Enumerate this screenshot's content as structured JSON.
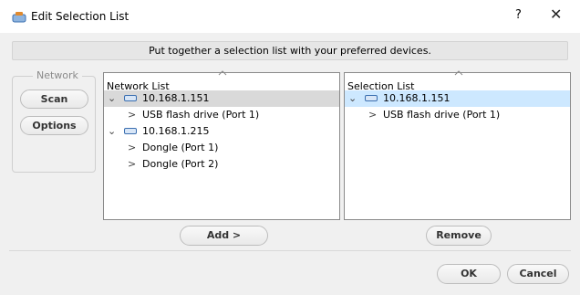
{
  "window": {
    "title": "Edit Selection List",
    "help_label": "?",
    "close_label": "✕"
  },
  "banner": {
    "text": "Put together a selection list with your preferred devices."
  },
  "network_group": {
    "legend": "Network",
    "scan_label": "Scan",
    "options_label": "Options"
  },
  "network_list": {
    "header": "Network List",
    "rows": [
      {
        "label": "10.168.1.151",
        "expander": "⌄",
        "type": "device"
      },
      {
        "label": "USB flash drive (Port 1)",
        "expander": ">",
        "type": "port"
      },
      {
        "label": "10.168.1.215",
        "expander": "⌄",
        "type": "device"
      },
      {
        "label": "Dongle (Port 1)",
        "expander": ">",
        "type": "port"
      },
      {
        "label": "Dongle (Port 2)",
        "expander": ">",
        "type": "port"
      }
    ]
  },
  "selection_list": {
    "header": "Selection List",
    "rows": [
      {
        "label": "10.168.1.151",
        "expander": "⌄",
        "type": "device"
      },
      {
        "label": "USB flash drive (Port 1)",
        "expander": ">",
        "type": "port"
      }
    ]
  },
  "buttons": {
    "add_label": "Add >",
    "remove_label": "Remove",
    "ok_label": "OK",
    "cancel_label": "Cancel"
  },
  "colors": {
    "dialog_bg": "#f0f0f0",
    "selected_gray": "#d9d9d9",
    "selected_blue": "#cde8ff",
    "drive_icon": "#3b6fb0"
  },
  "icons": {
    "app": "usb-hub-icon",
    "device": "network-drive-icon",
    "expand": "chevron-down-icon",
    "collapse": "chevron-right-icon"
  }
}
